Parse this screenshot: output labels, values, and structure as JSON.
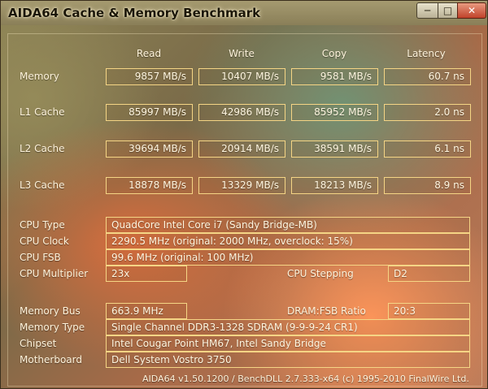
{
  "window": {
    "title": "AIDA64 Cache & Memory Benchmark",
    "controls": {
      "minimize": "─",
      "maximize": "□",
      "close": "✕"
    }
  },
  "columns": [
    "Read",
    "Write",
    "Copy",
    "Latency"
  ],
  "rows": [
    {
      "label": "Memory",
      "values": [
        "9857 MB/s",
        "10407 MB/s",
        "9581 MB/s",
        "60.7 ns"
      ]
    },
    {
      "label": "L1 Cache",
      "values": [
        "85997 MB/s",
        "42986 MB/s",
        "85952 MB/s",
        "2.0 ns"
      ]
    },
    {
      "label": "L2 Cache",
      "values": [
        "39694 MB/s",
        "20914 MB/s",
        "38591 MB/s",
        "6.1 ns"
      ]
    },
    {
      "label": "L3 Cache",
      "values": [
        "18878 MB/s",
        "13329 MB/s",
        "18213 MB/s",
        "8.9 ns"
      ]
    }
  ],
  "info": {
    "cpu_type_label": "CPU Type",
    "cpu_type": "QuadCore Intel Core i7  (Sandy Bridge-MB)",
    "cpu_clock_label": "CPU Clock",
    "cpu_clock": "2290.5 MHz  (original: 2000 MHz, overclock: 15%)",
    "cpu_fsb_label": "CPU FSB",
    "cpu_fsb": "99.6 MHz  (original: 100 MHz)",
    "cpu_multiplier_label": "CPU Multiplier",
    "cpu_multiplier": "23x",
    "cpu_stepping_label": "CPU Stepping",
    "cpu_stepping": "D2",
    "memory_bus_label": "Memory Bus",
    "memory_bus": "663.9 MHz",
    "dram_fsb_label": "DRAM:FSB Ratio",
    "dram_fsb": "20:3",
    "memory_type_label": "Memory Type",
    "memory_type": "Single Channel DDR3-1328 SDRAM  (9-9-9-24 CR1)",
    "chipset_label": "Chipset",
    "chipset": "Intel Cougar Point HM67, Intel Sandy Bridge",
    "motherboard_label": "Motherboard",
    "motherboard": "Dell System Vostro 3750"
  },
  "footer": "AIDA64 v1.50.1200 / BenchDLL 2.7.333-x64  (c) 1995-2010 FinalWire Ltd."
}
